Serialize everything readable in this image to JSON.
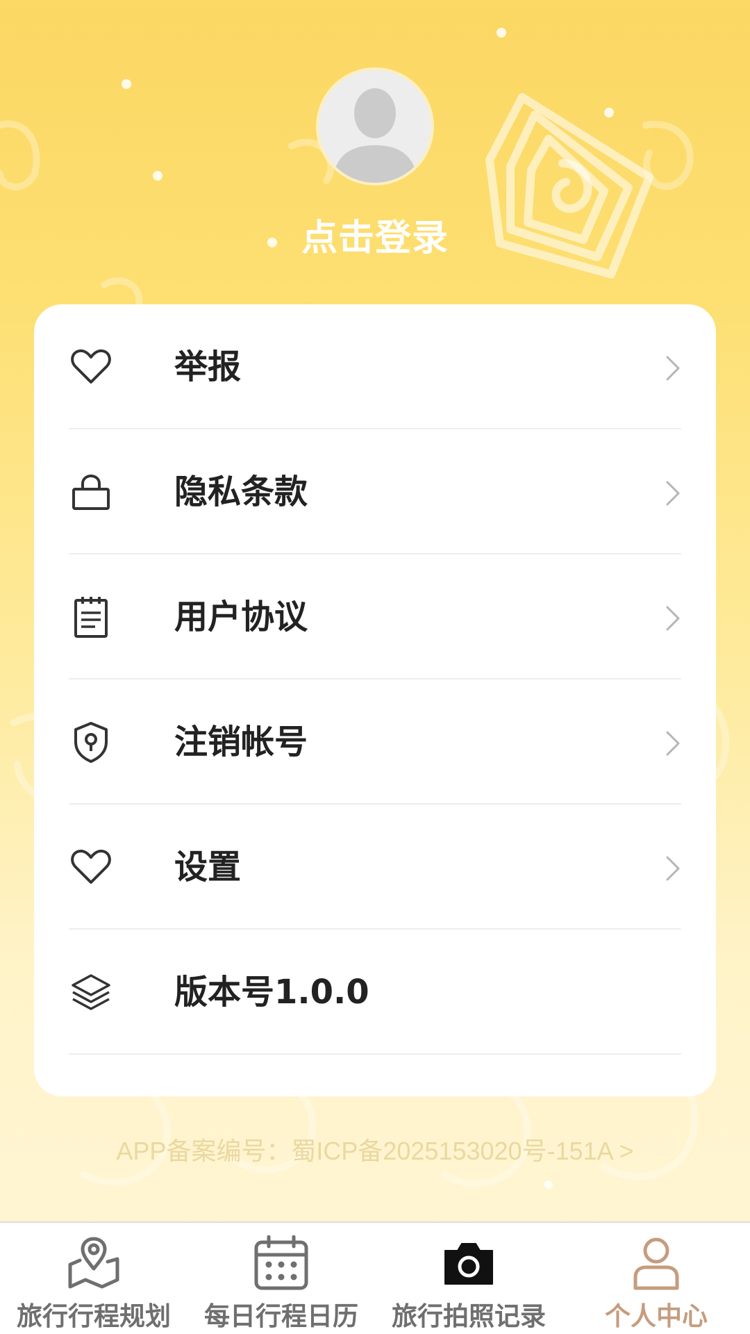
{
  "profile": {
    "login_label": "点击登录"
  },
  "menu": [
    {
      "label": "举报",
      "icon": "heart-icon",
      "has_chevron": true
    },
    {
      "label": "隐私条款",
      "icon": "lock-icon",
      "has_chevron": true
    },
    {
      "label": "用户协议",
      "icon": "notepad-icon",
      "has_chevron": true
    },
    {
      "label": "注销帐号",
      "icon": "shield-icon",
      "has_chevron": true
    },
    {
      "label": "设置",
      "icon": "heart-icon",
      "has_chevron": true
    },
    {
      "label": "版本号1.0.0",
      "icon": "layers-icon",
      "has_chevron": false
    }
  ],
  "footer": {
    "icp_text": "APP备案编号：蜀ICP备2025153020号-151A >"
  },
  "tabbar": {
    "tabs": [
      {
        "label": "旅行行程规划",
        "icon": "map-pin-icon",
        "active": false
      },
      {
        "label": "每日行程日历",
        "icon": "calendar-icon",
        "active": false
      },
      {
        "label": "旅行拍照记录",
        "icon": "camera-icon",
        "active": false
      },
      {
        "label": "个人中心",
        "icon": "user-icon",
        "active": true
      }
    ]
  },
  "colors": {
    "background_top": "#FBD763",
    "background_bottom": "#FFF6D6",
    "active_tab": "#C69C7E",
    "inactive_tab": "#6F6F6F",
    "label_text": "#222222"
  }
}
